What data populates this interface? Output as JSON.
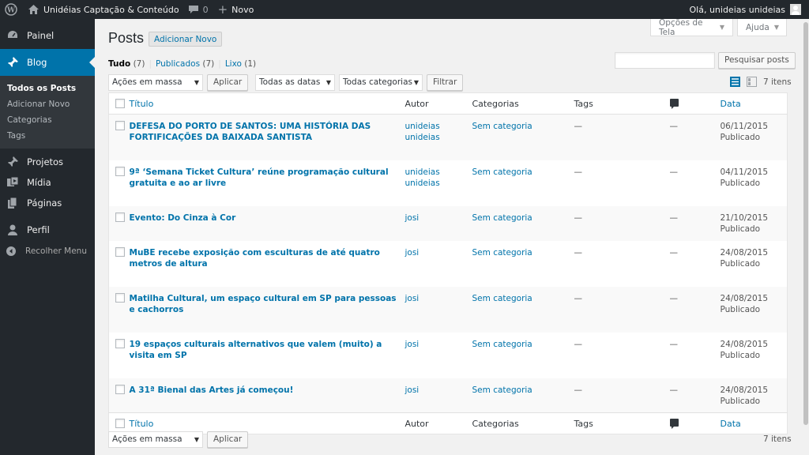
{
  "adminbar": {
    "site_name": "Unidéias Captação & Conteúdo",
    "comments_count": "0",
    "new_label": "Novo",
    "greeting": "Olá, unideias unideias"
  },
  "sidebar": {
    "items": [
      {
        "label": "Painel",
        "icon": "dashboard-icon"
      },
      {
        "label": "Blog",
        "icon": "pin-icon"
      },
      {
        "label": "Projetos",
        "icon": "pin-icon"
      },
      {
        "label": "Mídia",
        "icon": "media-icon"
      },
      {
        "label": "Páginas",
        "icon": "pages-icon"
      },
      {
        "label": "Perfil",
        "icon": "user-icon"
      }
    ],
    "submenu": [
      "Todos os Posts",
      "Adicionar Novo",
      "Categorias",
      "Tags"
    ],
    "collapse_label": "Recolher Menu"
  },
  "screen_meta": {
    "options_label": "Opções de Tela",
    "help_label": "Ajuda"
  },
  "page": {
    "title": "Posts",
    "add_new_label": "Adicionar Novo"
  },
  "filters": {
    "all_label": "Tudo",
    "all_count": "(7)",
    "published_label": "Publicados",
    "published_count": "(7)",
    "trash_label": "Lixo",
    "trash_count": "(1)",
    "search_button": "Pesquisar posts",
    "bulk_actions": "Ações em massa",
    "apply_label": "Aplicar",
    "dates_select": "Todas as datas",
    "categories_select": "Todas categorias",
    "filter_button": "Filtrar",
    "items_count": "7 itens"
  },
  "table": {
    "headers": {
      "title": "Título",
      "author": "Autor",
      "categories": "Categorias",
      "tags": "Tags",
      "date": "Data"
    },
    "rows": [
      {
        "title": "DEFESA DO PORTO DE SANTOS: UMA HISTÓRIA DAS FORTIFICAÇÕES DA BAIXADA SANTISTA",
        "author": "unideias unideias",
        "category": "Sem categoria",
        "tags": "—",
        "comments": "—",
        "date": "06/11/2015",
        "status": "Publicado"
      },
      {
        "title": "9ª ‘Semana Ticket Cultura’ reúne programação cultural gratuita e ao ar livre",
        "author": "unideias unideias",
        "category": "Sem categoria",
        "tags": "—",
        "comments": "—",
        "date": "04/11/2015",
        "status": "Publicado"
      },
      {
        "title": "Evento: Do Cinza à Cor",
        "author": "josi",
        "category": "Sem categoria",
        "tags": "—",
        "comments": "—",
        "date": "21/10/2015",
        "status": "Publicado"
      },
      {
        "title": "MuBE recebe exposição com esculturas de até quatro metros de altura",
        "author": "josi",
        "category": "Sem categoria",
        "tags": "—",
        "comments": "—",
        "date": "24/08/2015",
        "status": "Publicado"
      },
      {
        "title": "Matilha Cultural, um espaço cultural em SP para pessoas e cachorros",
        "author": "josi",
        "category": "Sem categoria",
        "tags": "—",
        "comments": "—",
        "date": "24/08/2015",
        "status": "Publicado"
      },
      {
        "title": "19 espaços culturais alternativos que valem (muito) a visita em SP",
        "author": "josi",
        "category": "Sem categoria",
        "tags": "—",
        "comments": "—",
        "date": "24/08/2015",
        "status": "Publicado"
      },
      {
        "title": "A 31ª Bienal das Artes já começou!",
        "author": "josi",
        "category": "Sem categoria",
        "tags": "—",
        "comments": "—",
        "date": "24/08/2015",
        "status": "Publicado"
      }
    ]
  },
  "colors": {
    "adminbar_bg": "#23282d",
    "accent": "#0073aa",
    "page_bg": "#f1f1f1"
  }
}
